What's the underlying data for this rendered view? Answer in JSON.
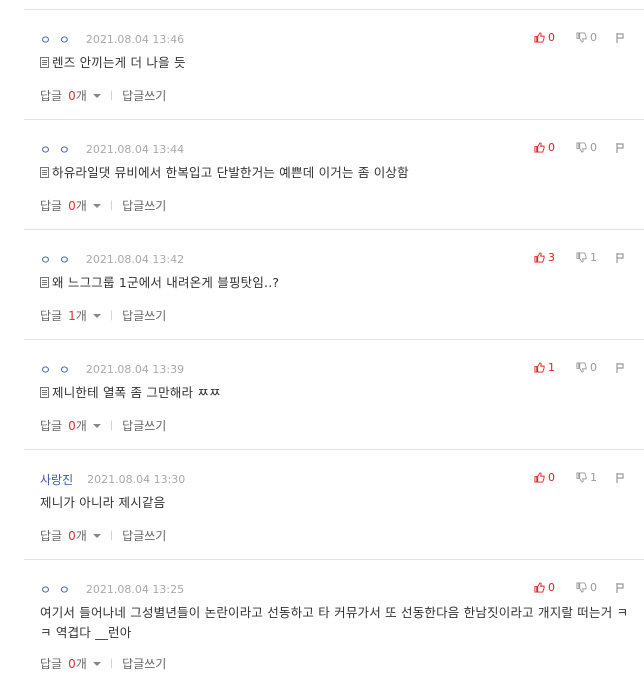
{
  "comments": [
    {
      "nick": "ㅇ ㅇ",
      "date": "2021.08.04 13:46",
      "up": "0",
      "down": "0",
      "memo": true,
      "text": "렌즈 안끼는게 더 나을 듯",
      "reply_label": "답글",
      "reply_count": "0",
      "reply_unit": "개",
      "write_label": "답글쓰기"
    },
    {
      "nick": "ㅇ ㅇ",
      "date": "2021.08.04 13:44",
      "up": "0",
      "down": "0",
      "memo": true,
      "text": "하유라일댓 뮤비에서 한복입고 단발한거는 예쁜데 이거는 좀 이상함",
      "reply_label": "답글",
      "reply_count": "0",
      "reply_unit": "개",
      "write_label": "답글쓰기"
    },
    {
      "nick": "ㅇ ㅇ",
      "date": "2021.08.04 13:42",
      "up": "3",
      "down": "1",
      "memo": true,
      "text": "왜 느그그룹 1군에서 내려온게 블핑탓임..?",
      "reply_label": "답글",
      "reply_count": "1",
      "reply_unit": "개",
      "write_label": "답글쓰기"
    },
    {
      "nick": "ㅇ ㅇ",
      "date": "2021.08.04 13:39",
      "up": "1",
      "down": "0",
      "memo": true,
      "text": "제니한테 열폭 좀 그만해라 ㅉㅉ",
      "reply_label": "답글",
      "reply_count": "0",
      "reply_unit": "개",
      "write_label": "답글쓰기"
    },
    {
      "nick": "사랑진",
      "date": "2021.08.04 13:30",
      "up": "0",
      "down": "1",
      "memo": false,
      "text": "제니가 아니라 제시같음",
      "reply_label": "답글",
      "reply_count": "0",
      "reply_unit": "개",
      "write_label": "답글쓰기"
    },
    {
      "nick": "ㅇ ㅇ",
      "date": "2021.08.04 13:25",
      "up": "0",
      "down": "0",
      "memo": false,
      "text": "여기서 들어나네 그성별년들이 논란이라고 선동하고 타 커뮤가서 또 선동한다음 한남짓이라고 개지랄 떠는거 ㅋㅋ 역겹다 __런아",
      "reply_label": "답글",
      "reply_count": "0",
      "reply_unit": "개",
      "write_label": "답글쓰기"
    }
  ],
  "icons": {
    "vote_up": "thumbs-up-icon",
    "vote_down": "thumbs-down-icon",
    "report": "report-flag-icon",
    "memo": "memo-icon",
    "caret": "caret-down-icon"
  },
  "colors": {
    "up": "#dd2222",
    "down": "#999999",
    "nick": "#445ea9",
    "reply_count": "#dd3333"
  }
}
